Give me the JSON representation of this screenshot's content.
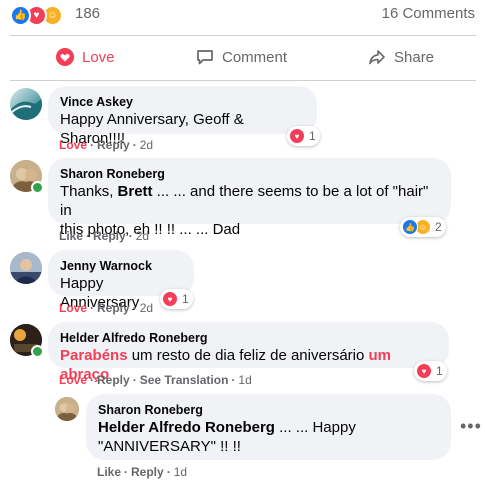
{
  "summary": {
    "reaction_count": "186",
    "comments_label": "16 Comments"
  },
  "actions": {
    "love": "Love",
    "comment": "Comment",
    "share": "Share"
  },
  "comments": [
    {
      "author": "Vince Askey",
      "text": "Happy Anniversary, Geoff & Sharon!!!!",
      "reaction_count": "1",
      "action1": "Love",
      "reply": "Reply",
      "time": "2d"
    },
    {
      "author": "Sharon Roneberg",
      "text_prefix": "Thanks, ",
      "text_bold": "Brett",
      "text_line1_rest": " ... ... and there seems to be a lot of \"hair\" in",
      "text_line2": "this photo, eh !! !! ... ... Dad",
      "reaction_count": "2",
      "action1": "Like",
      "reply": "Reply",
      "time": "2d"
    },
    {
      "author": "Jenny Warnock",
      "text": "Happy Anniversary",
      "reaction_count": "1",
      "action1": "Love",
      "reply": "Reply",
      "time": "2d"
    },
    {
      "author": "Helder Alfredo Roneberg",
      "text_pink1": "Parabéns",
      "text_middle": " um resto de dia feliz de aniversário ",
      "text_pink2": "um abraço",
      "reaction_count": "1",
      "action1": "Love",
      "reply": "Reply",
      "see_translation": "See Translation",
      "time": "1d"
    }
  ],
  "reply": {
    "author": "Sharon Roneberg",
    "text_bold": "Helder Alfredo Roneberg",
    "text_line1_rest": " ... ... Happy",
    "text_line2": "\"ANNIVERSARY\" !! !!",
    "action1": "Like",
    "reply": "Reply",
    "time": "1d"
  },
  "colors": {
    "love": "#f33e58",
    "like": "#1877f2",
    "bubble": "#f0f2f5",
    "meta": "#65676b"
  }
}
